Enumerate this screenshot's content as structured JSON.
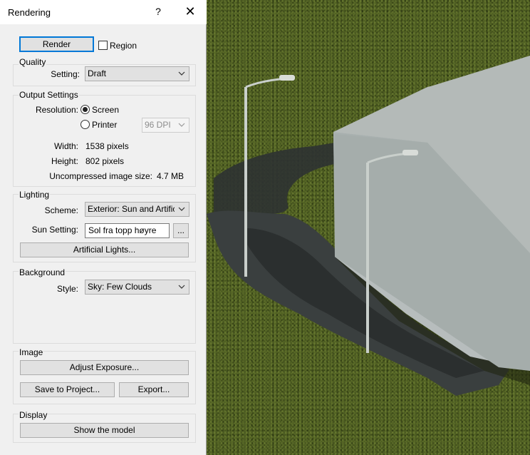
{
  "dialog": {
    "title": "Rendering",
    "help_label": "?",
    "close_label": "✕"
  },
  "render": {
    "button_label": "Render",
    "region_label": "Region",
    "region_checked": false
  },
  "quality": {
    "group_label": "Quality",
    "setting_label": "Setting:",
    "setting_value": "Draft"
  },
  "output": {
    "group_label": "Output Settings",
    "resolution_label": "Resolution:",
    "screen_label": "Screen",
    "printer_label": "Printer",
    "selected": "Screen",
    "dpi_value": "96 DPI",
    "width_label": "Width:",
    "width_value": "1538 pixels",
    "height_label": "Height:",
    "height_value": "802 pixels",
    "size_label": "Uncompressed image size:",
    "size_value": "4.7 MB"
  },
  "lighting": {
    "group_label": "Lighting",
    "scheme_label": "Scheme:",
    "scheme_value": "Exterior: Sun and Artificial",
    "sun_label": "Sun Setting:",
    "sun_value": "Sol fra topp høyre",
    "browse_label": "...",
    "artificial_button": "Artificial Lights..."
  },
  "background": {
    "group_label": "Background",
    "style_label": "Style:",
    "style_value": "Sky: Few Clouds"
  },
  "image": {
    "group_label": "Image",
    "adjust_button": "Adjust Exposure...",
    "save_button": "Save to Project...",
    "export_button": "Export..."
  },
  "display": {
    "group_label": "Display",
    "show_model_button": "Show the model"
  },
  "colors": {
    "dialog_bg": "#f0f0f0",
    "accent": "#0078d7",
    "grass": "#4b5a21"
  }
}
